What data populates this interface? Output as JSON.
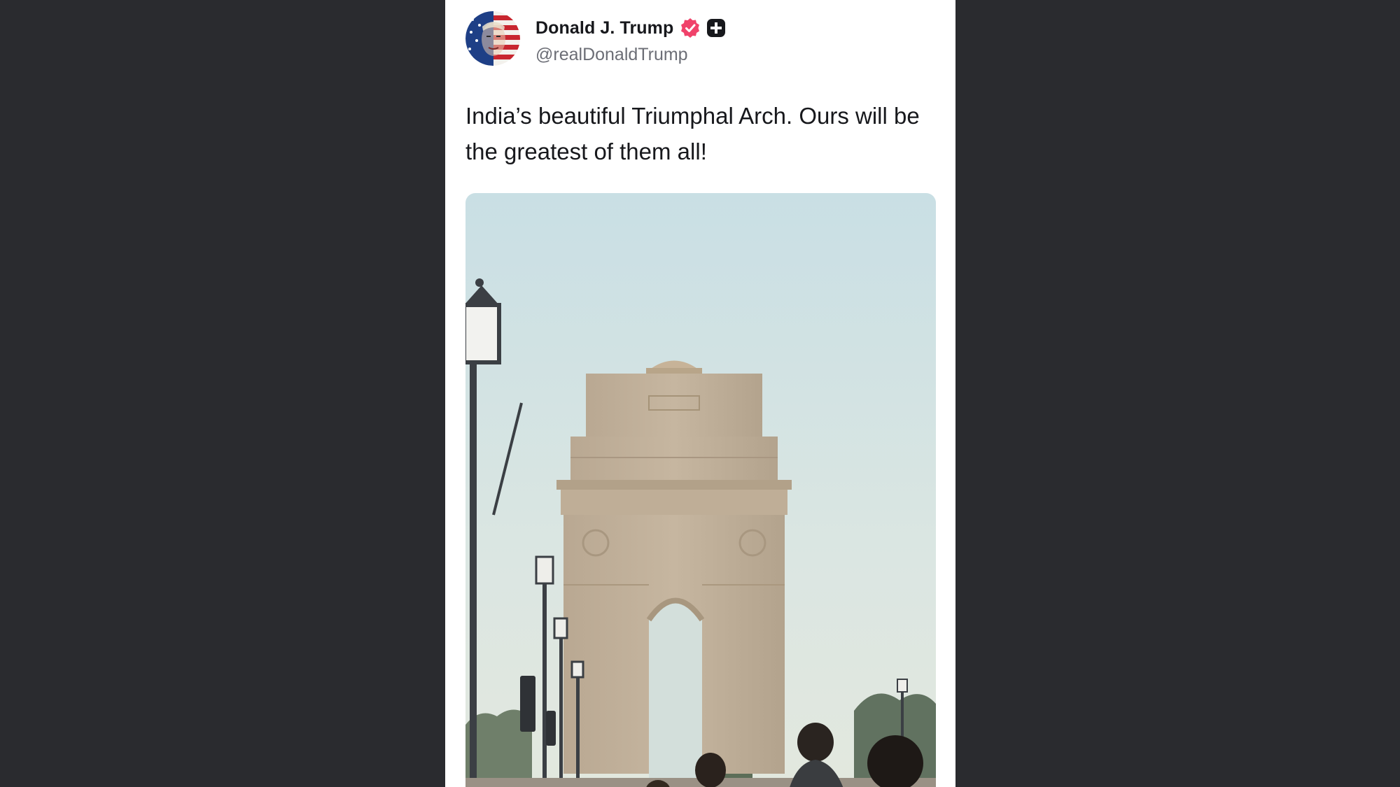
{
  "post": {
    "author_name": "Donald J. Trump",
    "author_handle": "@realDonaldTrump",
    "text": "India’s beautiful Triumphal Arch. Ours will be the greatest of them all!",
    "badges": [
      "verified-icon",
      "plus-icon"
    ],
    "image_subject": "India Gate"
  },
  "colors": {
    "background": "#2a2b2f",
    "card": "#ffffff",
    "verified_badge": "#f0426a",
    "name": "#17181c",
    "handle": "#6c6e76"
  }
}
